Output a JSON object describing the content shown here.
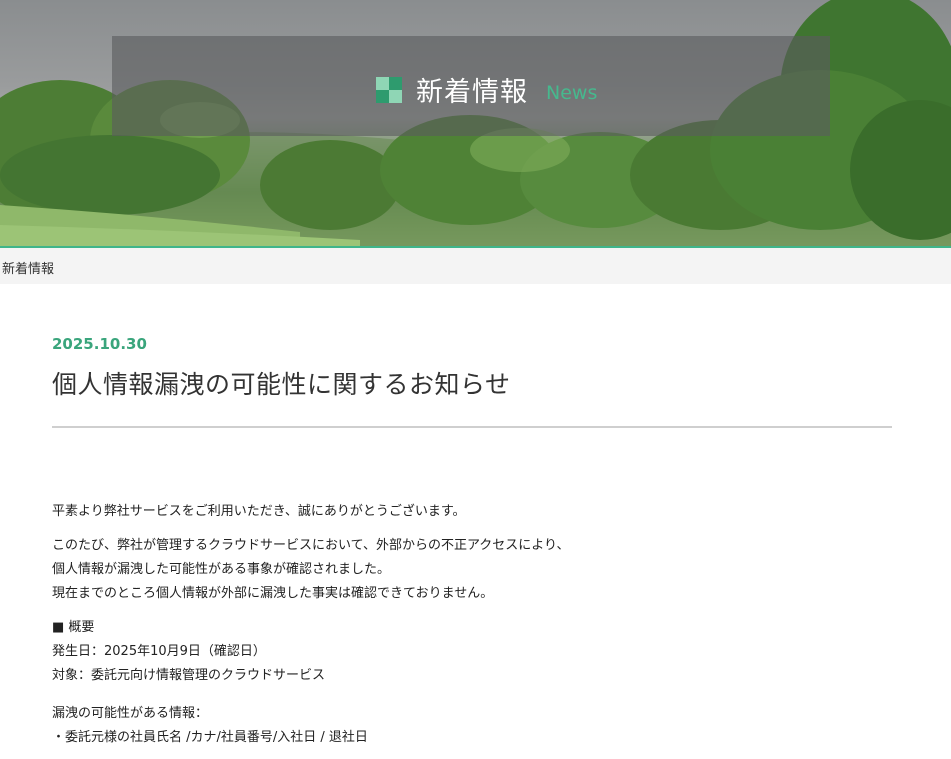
{
  "hero": {
    "title_ja": "新着情報",
    "title_en": "News",
    "colors": {
      "accent": "#3fb58a",
      "logo_dark": "#2e9b6e",
      "logo_light": "#8fd6b5"
    }
  },
  "breadcrumb": {
    "current": "新着情報"
  },
  "article": {
    "date": "2025.10.30",
    "title": "個人情報漏洩の可能性に関するお知らせ",
    "paragraphs": {
      "greeting": "平素より弊社サービスをご利用いただき、誠にありがとうございます。",
      "line1": "このたび、弊社が管理するクラウドサービスにおいて、外部からの不正アクセスにより、",
      "line2": "個人情報が漏洩した可能性がある事象が確認されました。",
      "line3": "現在までのところ個人情報が外部に漏洩した事実は確認できておりません。"
    },
    "overview": {
      "heading": "■ 概要",
      "occurred": "発生日：2025年10月9日（確認日）",
      "target": "対象：委託元向け情報管理のクラウドサービス"
    },
    "leak": {
      "heading": "漏洩の可能性がある情報：",
      "item1": "・委託元様の社員氏名 /カナ/社員番号/入社日 / 退社日"
    }
  }
}
